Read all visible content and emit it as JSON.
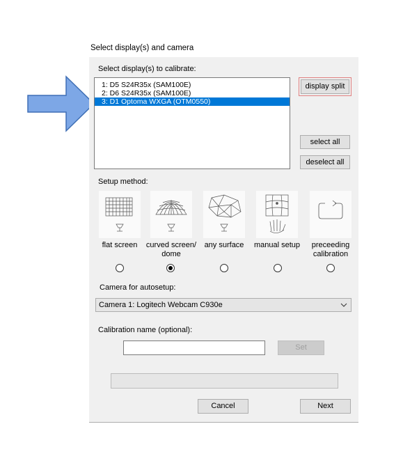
{
  "window_title": "Select display(s) and camera",
  "displays": {
    "label": "Select display(s) to calibrate:",
    "items": [
      "1: D5 S24R35x (SAM100E)",
      "2: D6 S24R35x (SAM100E)",
      "3: D1 Optoma WXGA (OTM0550)"
    ],
    "selected_index": 2,
    "display_split_label": "display split",
    "select_all_label": "select all",
    "deselect_all_label": "deselect all"
  },
  "setup": {
    "label": "Setup method:",
    "options": [
      {
        "label": "flat screen",
        "icon": "flat-screen-grid-icon",
        "selected": false
      },
      {
        "label": "curved screen/ dome",
        "icon": "dome-grid-icon",
        "selected": true
      },
      {
        "label": "any surface",
        "icon": "mesh-surface-icon",
        "selected": false
      },
      {
        "label": "manual setup",
        "icon": "manual-hand-icon",
        "selected": false
      },
      {
        "label": "preceeding calibration",
        "icon": "loop-arrow-icon",
        "selected": false
      }
    ]
  },
  "camera": {
    "label": "Camera for autosetup:",
    "selected": "Camera 1: Logitech Webcam C930e"
  },
  "calibration": {
    "label": "Calibration name (optional):",
    "value": "",
    "set_label": "Set"
  },
  "progress": 0,
  "footer": {
    "cancel_label": "Cancel",
    "next_label": "Next"
  },
  "colors": {
    "selection": "#0078d7",
    "arrow": "#7da7e6",
    "arrow_stroke": "#3f6fb5",
    "panel": "#f0f0f0"
  }
}
